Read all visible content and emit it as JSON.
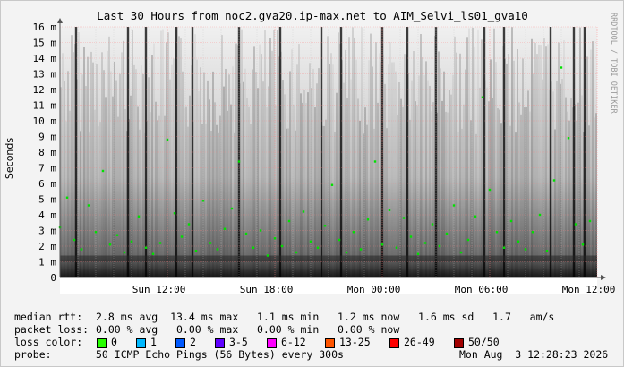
{
  "chart_data": {
    "type": "scatter",
    "title": "Last 30 Hours from noc2.gva20.ip-max.net to AIM_Selvi_ls01_gva10",
    "ylabel": "Seconds",
    "watermark": "RRDTOOL / TOBI OETIKER",
    "ylim": [
      0,
      16
    ],
    "y_unit": "m",
    "y_ticks": [
      "0",
      "1 m",
      "2 m",
      "3 m",
      "4 m",
      "5 m",
      "6 m",
      "7 m",
      "8 m",
      "9 m",
      "10 m",
      "11 m",
      "12 m",
      "13 m",
      "14 m",
      "15 m",
      "16 m"
    ],
    "x_ticks": [
      "Sun 12:00",
      "Sun 18:00",
      "Mon 00:00",
      "Mon 06:00",
      "Mon 12:00"
    ],
    "x_range_hours": [
      -30,
      0
    ],
    "grid": true,
    "colors": {
      "background": "#ffffff",
      "grid_minor": "#d8d8d8",
      "grid_major": "#ff8080",
      "median_points": "#00e000",
      "smoke": "#000000"
    },
    "series": [
      {
        "name": "0",
        "x_hours": [
          -30.0,
          -29.6,
          -29.2,
          -28.8,
          -28.4,
          -28.0,
          -27.6,
          -27.2,
          -26.8,
          -26.4,
          -26.0,
          -25.6,
          -25.2,
          -24.8,
          -24.4,
          -24.0,
          -23.6,
          -23.2,
          -22.8,
          -22.4,
          -22.0,
          -21.6,
          -21.2,
          -20.8,
          -20.4,
          -20.0,
          -19.6,
          -19.2,
          -18.8,
          -18.4,
          -18.0,
          -17.6,
          -17.2,
          -16.8,
          -16.4,
          -16.0,
          -15.6,
          -15.2,
          -14.8,
          -14.4,
          -14.0,
          -13.6,
          -13.2,
          -12.8,
          -12.4,
          -12.0,
          -11.6,
          -11.2,
          -10.8,
          -10.4,
          -10.0,
          -9.6,
          -9.2,
          -8.8,
          -8.4,
          -8.0,
          -7.6,
          -7.2,
          -6.8,
          -6.4,
          -6.0,
          -5.6,
          -5.2,
          -4.8,
          -4.4,
          -4.0,
          -3.6,
          -3.2,
          -2.8,
          -2.4,
          -2.0,
          -1.6,
          -1.2,
          -0.8,
          -0.4
        ],
        "y_ms": [
          3.2,
          5.1,
          2.4,
          1.8,
          4.6,
          2.9,
          6.8,
          2.1,
          2.7,
          1.6,
          2.3,
          3.9,
          1.9,
          1.5,
          2.2,
          8.8,
          4.1,
          2.6,
          3.4,
          1.7,
          4.9,
          2.2,
          1.8,
          3.1,
          4.4,
          7.4,
          2.8,
          1.9,
          3.0,
          1.4,
          2.5,
          2.0,
          3.6,
          1.6,
          4.2,
          2.3,
          1.9,
          3.3,
          5.9,
          2.4,
          1.6,
          2.9,
          1.8,
          3.7,
          7.4,
          2.1,
          4.3,
          1.9,
          3.8,
          2.6,
          1.5,
          2.2,
          3.4,
          2.0,
          2.8,
          4.6,
          1.6,
          2.4,
          3.9,
          11.5,
          5.6,
          2.9,
          1.9,
          3.6,
          2.3,
          1.8,
          2.9,
          4.0,
          1.7,
          6.2,
          13.4,
          8.9,
          3.4,
          2.1,
          3.6
        ]
      }
    ]
  },
  "stats": {
    "median_rtt_label": "median rtt:",
    "median_rtt_values": "2.8 ms avg  13.4 ms max   1.1 ms min   1.2 ms now   1.6 ms sd   1.7   am/s",
    "packet_loss_label": "packet loss:",
    "packet_loss_values": "0.00 % avg   0.00 % max   0.00 % min   0.00 % now",
    "loss_color_label": "loss color:",
    "probe_label": "probe:",
    "probe_value": "50 ICMP Echo Pings (56 Bytes) every 300s",
    "timestamp": "Mon Aug  3 12:28:23 2026"
  },
  "loss_legend": [
    {
      "label": "0",
      "color": "#26ff00"
    },
    {
      "label": "1",
      "color": "#00b8ff"
    },
    {
      "label": "2",
      "color": "#0059ff"
    },
    {
      "label": "3-5",
      "color": "#5e00ff"
    },
    {
      "label": "6-12",
      "color": "#ff00ff"
    },
    {
      "label": "13-25",
      "color": "#ff5500"
    },
    {
      "label": "26-49",
      "color": "#ff0000"
    },
    {
      "label": "50/50",
      "color": "#a10000"
    }
  ]
}
